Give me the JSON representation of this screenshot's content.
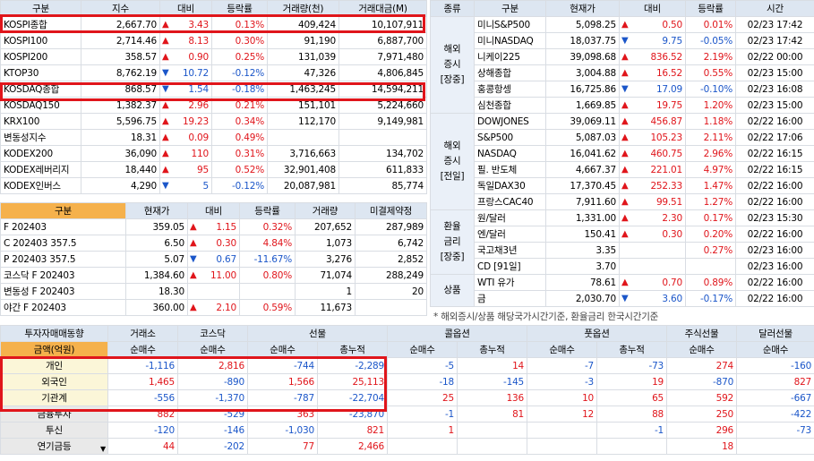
{
  "index_table": {
    "headers": [
      "구분",
      "지수",
      "대비",
      "등락률",
      "거래량(천)",
      "거래대금(M)"
    ],
    "rows": [
      {
        "name": "KOSPI종합",
        "value": "2,667.70",
        "dir": "up",
        "change": "3.43",
        "rate": "0.13%",
        "volume": "409,424",
        "amount": "10,107,911"
      },
      {
        "name": "KOSPI100",
        "value": "2,714.46",
        "dir": "up",
        "change": "8.13",
        "rate": "0.30%",
        "volume": "91,190",
        "amount": "6,887,700"
      },
      {
        "name": "KOSPI200",
        "value": "358.57",
        "dir": "up",
        "change": "0.90",
        "rate": "0.25%",
        "volume": "131,039",
        "amount": "7,971,480"
      },
      {
        "name": "KTOP30",
        "value": "8,762.19",
        "dir": "dn",
        "change": "10.72",
        "rate": "-0.12%",
        "volume": "47,326",
        "amount": "4,806,845"
      },
      {
        "name": "KOSDAQ종합",
        "value": "868.57",
        "dir": "dn",
        "change": "1.54",
        "rate": "-0.18%",
        "volume": "1,463,245",
        "amount": "14,594,211"
      },
      {
        "name": "KOSDAQ150",
        "value": "1,382.37",
        "dir": "up",
        "change": "2.96",
        "rate": "0.21%",
        "volume": "151,101",
        "amount": "5,224,660"
      },
      {
        "name": "KRX100",
        "value": "5,596.75",
        "dir": "up",
        "change": "19.23",
        "rate": "0.34%",
        "volume": "112,170",
        "amount": "9,149,981"
      },
      {
        "name": "변동성지수",
        "value": "18.31",
        "dir": "up",
        "change": "0.09",
        "rate": "0.49%",
        "volume": "",
        "amount": ""
      },
      {
        "name": "KODEX200",
        "value": "36,090",
        "dir": "up",
        "change": "110",
        "rate": "0.31%",
        "volume": "3,716,663",
        "amount": "134,702"
      },
      {
        "name": "KODEX레버리지",
        "value": "18,440",
        "dir": "up",
        "change": "95",
        "rate": "0.52%",
        "volume": "32,901,408",
        "amount": "611,833"
      },
      {
        "name": "KODEX인버스",
        "value": "4,290",
        "dir": "dn",
        "change": "5",
        "rate": "-0.12%",
        "volume": "20,087,981",
        "amount": "85,774"
      }
    ]
  },
  "futures_table": {
    "headers": [
      "구분",
      "현재가",
      "대비",
      "등락률",
      "거래량",
      "미결제약정"
    ],
    "rows": [
      {
        "name": "F 202403",
        "price": "359.05",
        "dir": "up",
        "change": "1.15",
        "rate": "0.32%",
        "volume": "207,652",
        "oi": "287,989"
      },
      {
        "name": "C 202403 357.5",
        "price": "6.50",
        "dir": "up",
        "change": "0.30",
        "rate": "4.84%",
        "volume": "1,073",
        "oi": "6,742"
      },
      {
        "name": "P 202403 357.5",
        "price": "5.07",
        "dir": "dn",
        "change": "0.67",
        "rate": "-11.67%",
        "volume": "3,276",
        "oi": "2,852"
      },
      {
        "name": "코스닥 F 202403",
        "price": "1,384.60",
        "dir": "up",
        "change": "11.00",
        "rate": "0.80%",
        "volume": "71,074",
        "oi": "288,249"
      },
      {
        "name": "변동성 F 202403",
        "price": "18.30",
        "dir": "",
        "change": "",
        "rate": "",
        "volume": "1",
        "oi": "20"
      },
      {
        "name": "야간  F 202403",
        "price": "360.00",
        "dir": "up",
        "change": "2.10",
        "rate": "0.59%",
        "volume": "11,673",
        "oi": ""
      }
    ]
  },
  "global_table": {
    "headers": [
      "종류",
      "구분",
      "현재가",
      "대비",
      "등락률",
      "시간"
    ],
    "groups": [
      {
        "label": "해외\n증시\n[장중]",
        "rows": [
          {
            "name": "미니S&P500",
            "price": "5,098.25",
            "dir": "up",
            "change": "0.50",
            "rate": "0.01%",
            "time": "02/23 17:42"
          },
          {
            "name": "미니NASDAQ",
            "price": "18,037.75",
            "dir": "dn",
            "change": "9.75",
            "rate": "-0.05%",
            "time": "02/23 17:42"
          },
          {
            "name": "니케이225",
            "price": "39,098.68",
            "dir": "up",
            "change": "836.52",
            "rate": "2.19%",
            "time": "02/22 00:00"
          },
          {
            "name": "상해종합",
            "price": "3,004.88",
            "dir": "up",
            "change": "16.52",
            "rate": "0.55%",
            "time": "02/23 15:00"
          },
          {
            "name": "홍콩항셍",
            "price": "16,725.86",
            "dir": "dn",
            "change": "17.09",
            "rate": "-0.10%",
            "time": "02/23 16:08"
          },
          {
            "name": "심천종합",
            "price": "1,669.85",
            "dir": "up",
            "change": "19.75",
            "rate": "1.20%",
            "time": "02/23 15:00"
          }
        ]
      },
      {
        "label": "해외\n증시\n[전일]",
        "rows": [
          {
            "name": "DOWJONES",
            "price": "39,069.11",
            "dir": "up",
            "change": "456.87",
            "rate": "1.18%",
            "time": "02/22 16:00"
          },
          {
            "name": "S&P500",
            "price": "5,087.03",
            "dir": "up",
            "change": "105.23",
            "rate": "2.11%",
            "time": "02/22 17:06"
          },
          {
            "name": "NASDAQ",
            "price": "16,041.62",
            "dir": "up",
            "change": "460.75",
            "rate": "2.96%",
            "time": "02/22 16:15"
          },
          {
            "name": "필. 반도체",
            "price": "4,667.37",
            "dir": "up",
            "change": "221.01",
            "rate": "4.97%",
            "time": "02/22 16:15"
          },
          {
            "name": "독일DAX30",
            "price": "17,370.45",
            "dir": "up",
            "change": "252.33",
            "rate": "1.47%",
            "time": "02/22 16:00"
          },
          {
            "name": "프랑스CAC40",
            "price": "7,911.60",
            "dir": "up",
            "change": "99.51",
            "rate": "1.27%",
            "time": "02/22 16:00"
          }
        ]
      },
      {
        "label": "환율\n금리\n[장중]",
        "rows": [
          {
            "name": "원/달러",
            "price": "1,331.00",
            "dir": "up",
            "change": "2.30",
            "rate": "0.17%",
            "time": "02/23 15:30"
          },
          {
            "name": "엔/달러",
            "price": "150.41",
            "dir": "up",
            "change": "0.30",
            "rate": "0.20%",
            "time": "02/22 16:00"
          },
          {
            "name": "국고채3년",
            "price": "3.35",
            "dir": "",
            "change": "",
            "rate": "0.27%",
            "time": "02/23 16:00"
          },
          {
            "name": "CD [91일]",
            "price": "3.70",
            "dir": "",
            "change": "",
            "rate": "",
            "time": "02/23 16:00"
          }
        ]
      },
      {
        "label": "상품",
        "rows": [
          {
            "name": "WTI 유가",
            "price": "78.61",
            "dir": "up",
            "change": "0.70",
            "rate": "0.89%",
            "time": "02/22 16:00"
          },
          {
            "name": "금",
            "price": "2,030.70",
            "dir": "dn",
            "change": "3.60",
            "rate": "-0.17%",
            "time": "02/22 16:00"
          }
        ]
      }
    ]
  },
  "note": "* 해외증시/상품 해당국가시간기준, 환율금리 한국시간기준",
  "investor_table": {
    "title": "투자자매매동향",
    "unit_label": "금액(억원)",
    "groups": [
      "거래소",
      "코스닥",
      "선물",
      "콜옵션",
      "풋옵션",
      "주식선물",
      "달러선물"
    ],
    "subheaders": [
      "순매수",
      "순매수",
      "순매수",
      "총누적",
      "순매수",
      "총누적",
      "순매수",
      "총누적",
      "순매수",
      "순매수"
    ],
    "rows": [
      {
        "name": "개인",
        "vals": [
          "-1,116",
          "2,816",
          "-744",
          "-2,289",
          "-5",
          "14",
          "-7",
          "-73",
          "274",
          "-160"
        ]
      },
      {
        "name": "외국인",
        "vals": [
          "1,465",
          "-890",
          "1,566",
          "25,113",
          "-18",
          "-145",
          "-3",
          "19",
          "-870",
          "827"
        ]
      },
      {
        "name": "기관계",
        "vals": [
          "-556",
          "-1,370",
          "-787",
          "-22,704",
          "25",
          "136",
          "10",
          "65",
          "592",
          "-667"
        ]
      },
      {
        "name": "금융투자",
        "vals": [
          "882",
          "-529",
          "363",
          "-23,870",
          "-1",
          "81",
          "12",
          "88",
          "250",
          "-422"
        ]
      },
      {
        "name": "투신",
        "vals": [
          "-120",
          "-146",
          "-1,030",
          "821",
          "1",
          "",
          "",
          "-1",
          "296",
          "-73"
        ]
      },
      {
        "name": "연기금등",
        "vals": [
          "44",
          "-202",
          "77",
          "2,466",
          "",
          "",
          "",
          "",
          "18",
          ""
        ]
      }
    ]
  },
  "colors": {
    "up": "#e0151b",
    "down": "#1b56c9",
    "header": "#dde6f1",
    "highlight": "#e0151b",
    "orange": "#f5b14c"
  },
  "icons": {
    "up": "triangle-up",
    "down": "triangle-down",
    "dropdown": "chevron-down"
  }
}
